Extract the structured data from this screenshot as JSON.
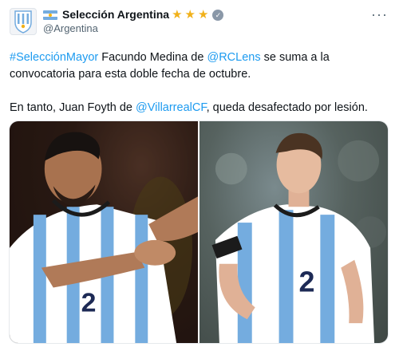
{
  "account": {
    "name": "Selección Argentina",
    "handle": "@Argentina",
    "stars": [
      "★",
      "★",
      "★"
    ]
  },
  "tweet": {
    "line1": {
      "hashtag": "#SelecciónMayor",
      "text_a": " Facundo Medina de ",
      "mention": "@RCLens",
      "text_b": " se suma a la"
    },
    "line2": "convocatoria para esta doble fecha de octubre.",
    "line3": {
      "text_a": "En tanto, Juan Foyth de ",
      "mention": "@VillarrealCF",
      "text_b": ", queda desafectado por lesión."
    }
  },
  "media": {
    "jersey_number": "2"
  },
  "colors": {
    "link": "#1d9bf0",
    "star": "#f1b11a",
    "jersey_blue": "#74acdf"
  }
}
